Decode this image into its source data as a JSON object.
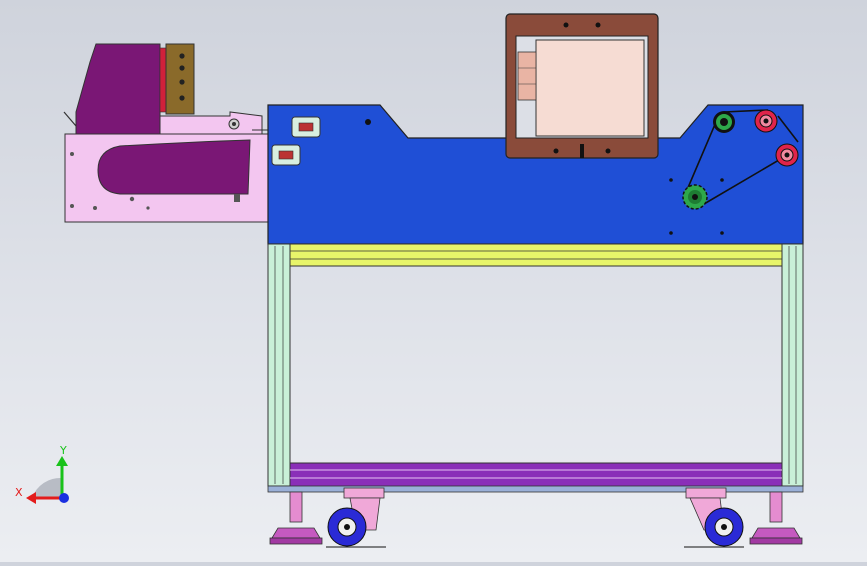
{
  "viewport": {
    "background": "#dcdfe6",
    "triad": {
      "x_label": "X",
      "y_label": "Y",
      "x_color": "#e31b1b",
      "y_color": "#19c21a",
      "z_color": "#1a2fe0"
    }
  },
  "model": {
    "colors": {
      "main_panel": "#1f4fd6",
      "frame_legs": "#c9f0d8",
      "top_rail": "#e8f56a",
      "bottom_rail": "#8a2fb8",
      "feeder_plate": "#f3c6f0",
      "feeder_body": "#7a1775",
      "bracket": "#8a6a2a",
      "monitor_frame": "#8a4b3a",
      "monitor_screen": "#f6dcd3",
      "wheel": "#2a2ad6",
      "caster_bracket": "#f0a8d8",
      "foot_pad": "#c55ac0",
      "pulley_green": "#2ea84a",
      "pulley_red": "#e0244a"
    }
  }
}
